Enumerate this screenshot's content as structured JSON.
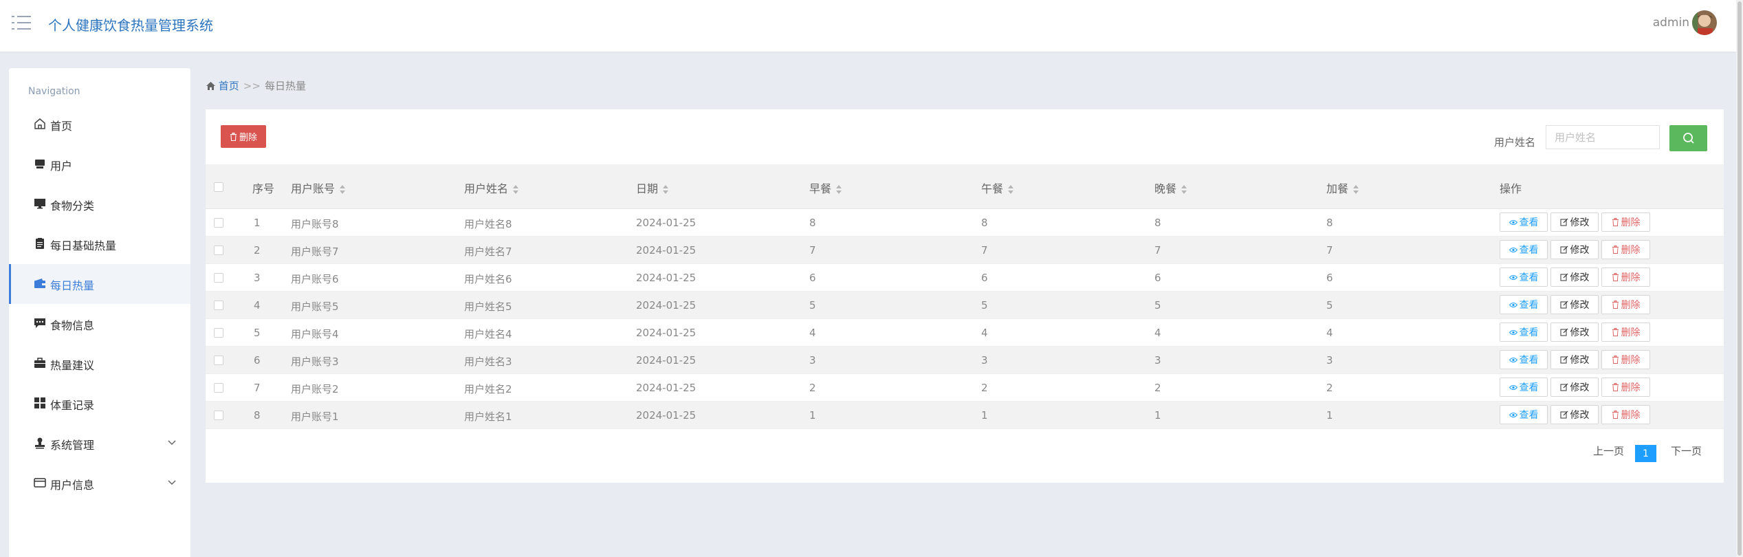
{
  "header": {
    "title": "个人健康饮食热量管理系统",
    "username": "admin"
  },
  "sidebar": {
    "nav_title": "Navigation",
    "items": [
      {
        "label": "首页",
        "icon": "home-icon"
      },
      {
        "label": "用户",
        "icon": "user-card-icon"
      },
      {
        "label": "食物分类",
        "icon": "monitor-icon"
      },
      {
        "label": "每日基础热量",
        "icon": "clipboard-icon"
      },
      {
        "label": "每日热量",
        "icon": "wallet-icon",
        "active": true
      },
      {
        "label": "食物信息",
        "icon": "chat-icon"
      },
      {
        "label": "热量建议",
        "icon": "briefcase-icon"
      },
      {
        "label": "体重记录",
        "icon": "grid-icon"
      },
      {
        "label": "系统管理",
        "icon": "stamp-icon",
        "expandable": true
      },
      {
        "label": "用户信息",
        "icon": "card-icon",
        "expandable": true
      }
    ]
  },
  "breadcrumb": {
    "home": "首页",
    "separator": ">>",
    "current": "每日热量"
  },
  "toolbar": {
    "delete_label": "删除",
    "search_label": "用户姓名",
    "search_placeholder": "用户姓名",
    "search_value": ""
  },
  "table": {
    "columns": [
      "序号",
      "用户账号",
      "用户姓名",
      "日期",
      "早餐",
      "午餐",
      "晚餐",
      "加餐",
      "操作"
    ],
    "rows": [
      {
        "idx": "1",
        "account": "用户账号8",
        "name": "用户姓名8",
        "date": "2024-01-25",
        "breakfast": "8",
        "lunch": "8",
        "dinner": "8",
        "snack": "8"
      },
      {
        "idx": "2",
        "account": "用户账号7",
        "name": "用户姓名7",
        "date": "2024-01-25",
        "breakfast": "7",
        "lunch": "7",
        "dinner": "7",
        "snack": "7"
      },
      {
        "idx": "3",
        "account": "用户账号6",
        "name": "用户姓名6",
        "date": "2024-01-25",
        "breakfast": "6",
        "lunch": "6",
        "dinner": "6",
        "snack": "6"
      },
      {
        "idx": "4",
        "account": "用户账号5",
        "name": "用户姓名5",
        "date": "2024-01-25",
        "breakfast": "5",
        "lunch": "5",
        "dinner": "5",
        "snack": "5"
      },
      {
        "idx": "5",
        "account": "用户账号4",
        "name": "用户姓名4",
        "date": "2024-01-25",
        "breakfast": "4",
        "lunch": "4",
        "dinner": "4",
        "snack": "4"
      },
      {
        "idx": "6",
        "account": "用户账号3",
        "name": "用户姓名3",
        "date": "2024-01-25",
        "breakfast": "3",
        "lunch": "3",
        "dinner": "3",
        "snack": "3"
      },
      {
        "idx": "7",
        "account": "用户账号2",
        "name": "用户姓名2",
        "date": "2024-01-25",
        "breakfast": "2",
        "lunch": "2",
        "dinner": "2",
        "snack": "2"
      },
      {
        "idx": "8",
        "account": "用户账号1",
        "name": "用户姓名1",
        "date": "2024-01-25",
        "breakfast": "1",
        "lunch": "1",
        "dinner": "1",
        "snack": "1"
      }
    ],
    "actions": {
      "view": "查看",
      "edit": "修改",
      "delete": "删除"
    }
  },
  "pagination": {
    "prev": "上一页",
    "current": "1",
    "next": "下一页"
  },
  "colors": {
    "brand": "#2e75c0",
    "active": "#3c7dd9",
    "danger": "#d9534f",
    "success": "#5cb85c",
    "page_active": "#1e9fff"
  }
}
